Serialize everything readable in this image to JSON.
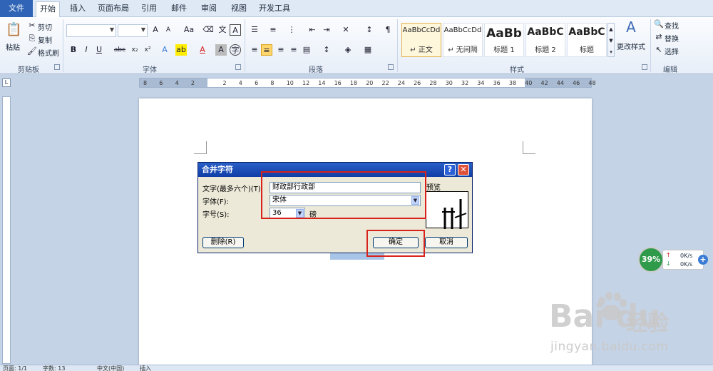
{
  "tabs": [
    "文件",
    "开始",
    "插入",
    "页面布局",
    "引用",
    "邮件",
    "审阅",
    "视图",
    "开发工具"
  ],
  "clipboard": {
    "paste": "粘贴",
    "cut": "剪切",
    "copy": "复制",
    "format_painter": "格式刷",
    "label": "剪贴板"
  },
  "font_group": {
    "label": "字体"
  },
  "paragraph_group": {
    "label": "段落"
  },
  "styles_group": {
    "label": "样式",
    "items": [
      {
        "preview": "AaBbCcDd",
        "name": "↵ 正文"
      },
      {
        "preview": "AaBbCcDd",
        "name": "↵ 无间隔"
      },
      {
        "preview": "AaBb",
        "name": "标题 1"
      },
      {
        "preview": "AaBbC",
        "name": "标题 2"
      },
      {
        "preview": "AaBbC",
        "name": "标题"
      }
    ],
    "change_styles": "更改样式"
  },
  "editing": {
    "find": "查找",
    "replace": "替换",
    "select": "选择",
    "label": "编辑"
  },
  "ruler": {
    "numbers": [
      "8",
      "6",
      "4",
      "2",
      "2",
      "4",
      "6",
      "8",
      "10",
      "12",
      "14",
      "16",
      "18",
      "20",
      "22",
      "24",
      "26",
      "28",
      "30",
      "32",
      "34",
      "36",
      "38",
      "40",
      "42",
      "44",
      "46",
      "48"
    ]
  },
  "dialog": {
    "title": "合并字符",
    "text_label": "文字(最多六个)(T):",
    "text_value": "财政部行政部",
    "font_label": "字体(F):",
    "font_value": "宋体",
    "size_label": "字号(S):",
    "size_value": "36",
    "size_unit": "磅",
    "preview_label": "预览",
    "delete_button": "删除(R)",
    "ok_button": "确定",
    "cancel_button": "取消"
  },
  "net_widget": {
    "percent": "39%",
    "up": "0K/s",
    "down": "0K/s"
  },
  "watermark": {
    "logo": "Bai du",
    "cn": "经验",
    "url": "jingyan.baidu.com"
  },
  "status": {
    "page": "页面: 1/1",
    "words": "字数: 13",
    "lang": "中文(中国)",
    "mode": "插入"
  }
}
